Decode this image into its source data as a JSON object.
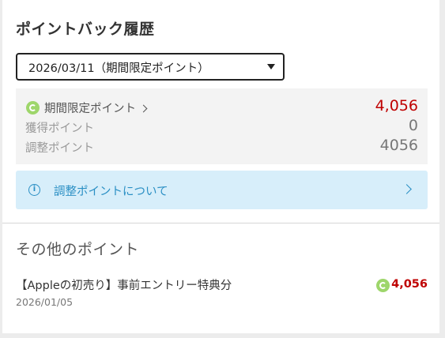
{
  "header": {
    "title": "ポイントバック履歴"
  },
  "period_select": {
    "selected": "2026/03/11（期間限定ポイント）"
  },
  "summary": {
    "rows": [
      {
        "label": "期間限定ポイント",
        "value": "4,056",
        "icon": "point-coin-icon"
      },
      {
        "label": "獲得ポイント",
        "value": "0"
      },
      {
        "label": "調整ポイント",
        "value": "4056"
      }
    ]
  },
  "info_banner": {
    "label": "調整ポイントについて",
    "icon": "info-icon"
  },
  "other_points": {
    "title": "その他のポイント",
    "items": [
      {
        "name": "【Appleの初売り】事前エントリー特典分",
        "date": "2026/01/05",
        "value": "4,056"
      }
    ]
  },
  "colors": {
    "accent_red": "#bf0000",
    "info_blue": "#2a8fc4",
    "info_bg": "#d7eefa",
    "coin_green": "#9ed66b"
  }
}
